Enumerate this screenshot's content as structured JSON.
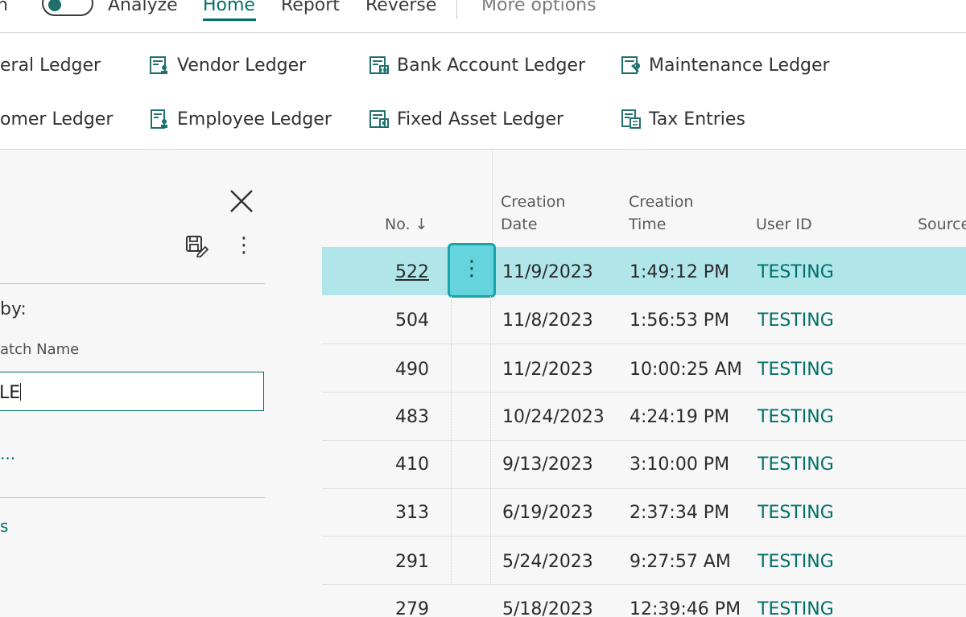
{
  "actionbar": {
    "truncated_item": "n",
    "analyze": "Analyze",
    "home": "Home",
    "report": "Report",
    "reverse": "Reverse",
    "more_options": "More options"
  },
  "ledger": {
    "general": "eral Ledger",
    "customer": "omer Ledger",
    "vendor": "Vendor Ledger",
    "employee": "Employee Ledger",
    "bank": "Bank Account Ledger",
    "fixed_asset": "Fixed Asset Ledger",
    "maintenance": "Maintenance Ledger",
    "tax": "Tax Entries"
  },
  "filterpane": {
    "filter_by": "by:",
    "field_label": "atch Name",
    "field_value": "LE",
    "link1": "...",
    "link2": "s"
  },
  "table": {
    "headers": {
      "no": "No. ↓",
      "creation_date_1": "Creation",
      "creation_date_2": "Date",
      "creation_time_1": "Creation",
      "creation_time_2": "Time",
      "user_id": "User ID",
      "source": "Source"
    },
    "rows": [
      {
        "no": "522",
        "date": "11/9/2023",
        "time": "1:49:12 PM",
        "user": "TESTING"
      },
      {
        "no": "504",
        "date": "11/8/2023",
        "time": "1:56:53 PM",
        "user": "TESTING"
      },
      {
        "no": "490",
        "date": "11/2/2023",
        "time": "10:00:25 AM",
        "user": "TESTING"
      },
      {
        "no": "483",
        "date": "10/24/2023",
        "time": "4:24:19 PM",
        "user": "TESTING"
      },
      {
        "no": "410",
        "date": "9/13/2023",
        "time": "3:10:00 PM",
        "user": "TESTING"
      },
      {
        "no": "313",
        "date": "6/19/2023",
        "time": "2:37:34 PM",
        "user": "TESTING"
      },
      {
        "no": "291",
        "date": "5/24/2023",
        "time": "9:27:57 AM",
        "user": "TESTING"
      },
      {
        "no": "279",
        "date": "5/18/2023",
        "time": "12:39:46 PM",
        "user": "TESTING"
      }
    ],
    "row_menu_glyph": "⋮"
  },
  "colors": {
    "accent": "#00706b",
    "selected_row": "#b0e6ea",
    "row_button": "#65d4dc"
  }
}
